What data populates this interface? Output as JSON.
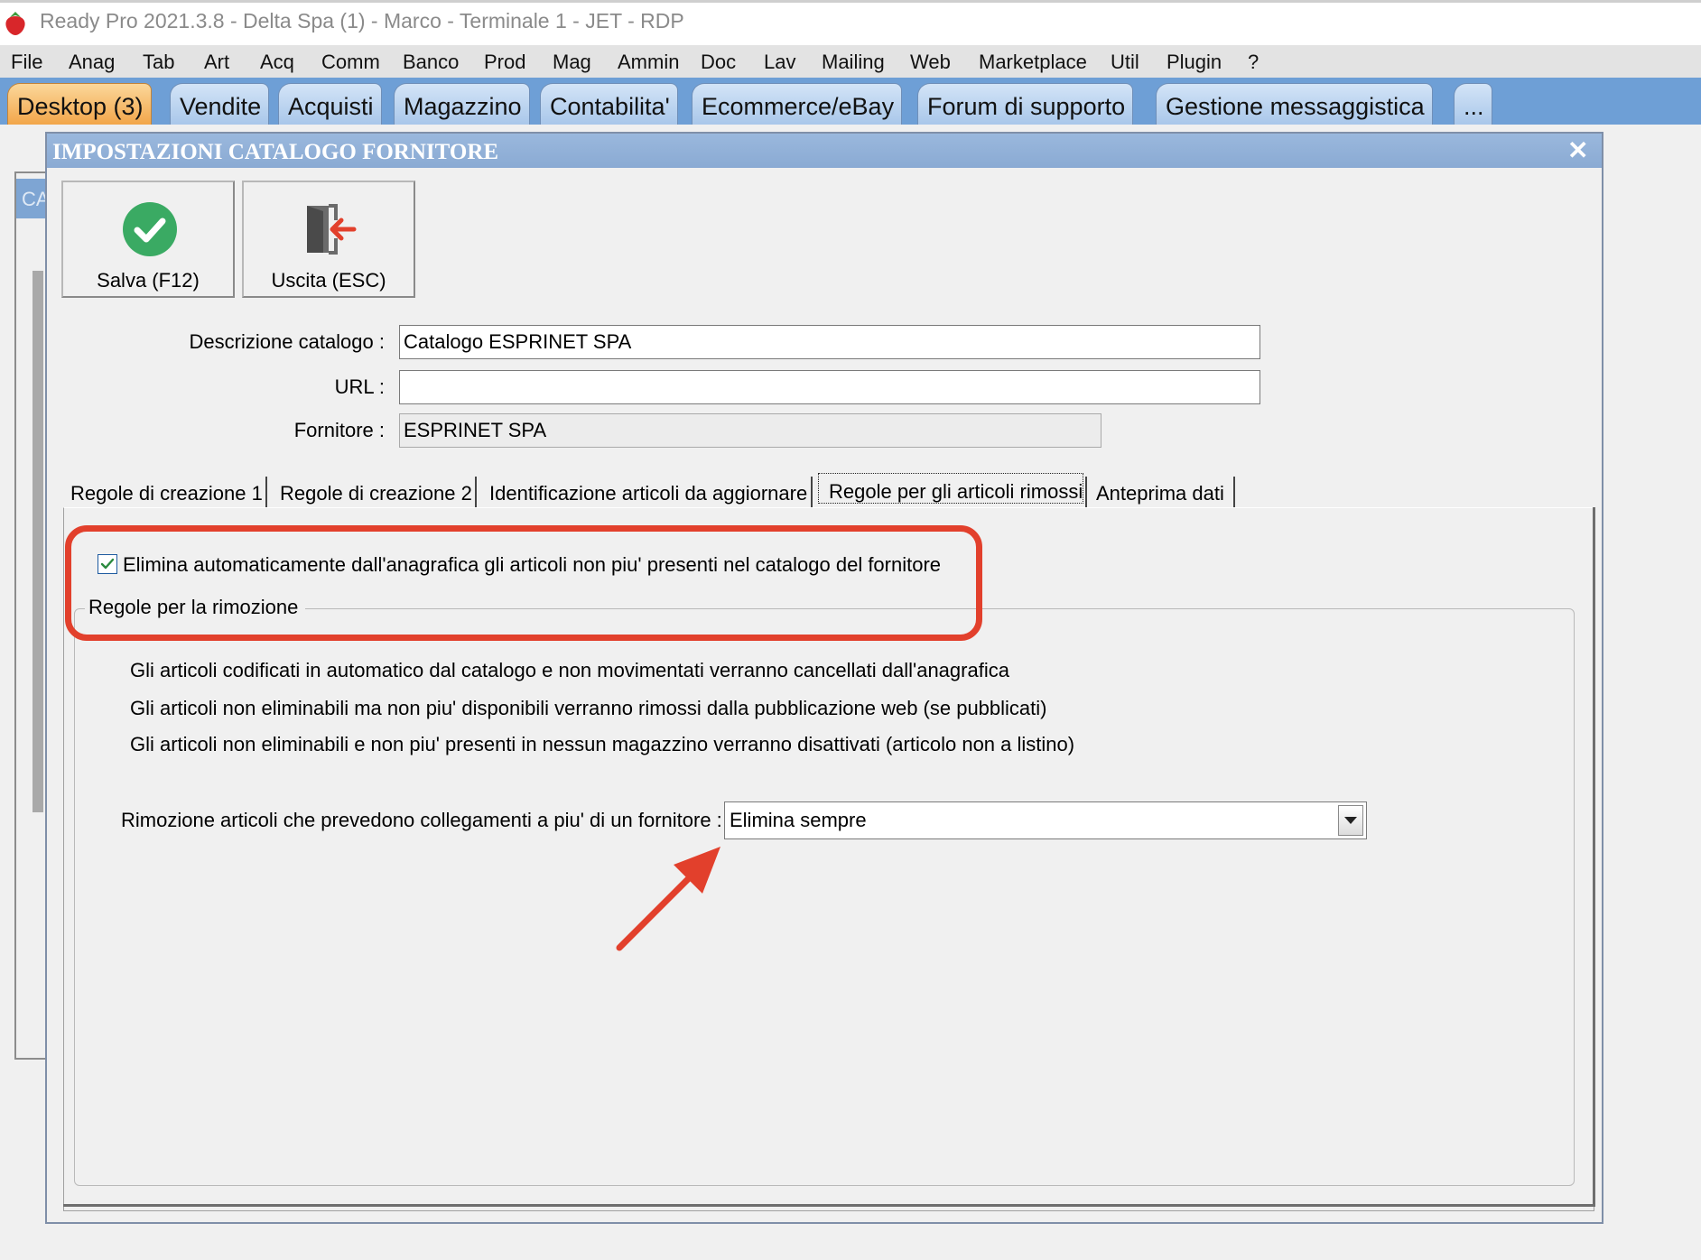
{
  "window": {
    "title": "Ready Pro 2021.3.8 - Delta Spa (1) - Marco - Terminale 1 - JET - RDP"
  },
  "menu": [
    "File",
    "Anag",
    "Tab",
    "Art",
    "Acq",
    "Comm",
    "Banco",
    "Prod",
    "Mag",
    "Ammin",
    "Doc",
    "Lav",
    "Mailing",
    "Web",
    "Marketplace",
    "Util",
    "Plugin",
    "?"
  ],
  "top_tabs": [
    "Desktop (3)",
    "Vendite",
    "Acquisti",
    "Magazzino",
    "Contabilita'",
    "Ecommerce/eBay",
    "Forum di supporto",
    "Gestione messaggistica",
    "..."
  ],
  "background": {
    "tab_fragment": "CA"
  },
  "dialog": {
    "title": "IMPOSTAZIONI CATALOGO FORNITORE",
    "close_glyph": "✕",
    "toolbar": {
      "save_label": "Salva (F12)",
      "exit_label": "Uscita (ESC)"
    },
    "fields": {
      "descrizione_label": "Descrizione catalogo :",
      "descrizione_value": "Catalogo ESPRINET SPA",
      "url_label": "URL :",
      "url_value": "",
      "fornitore_label": "Fornitore :",
      "fornitore_value": "ESPRINET SPA"
    },
    "tabs": [
      "Regole di creazione 1",
      "Regole di creazione 2",
      "Identificazione articoli da aggiornare",
      "Regole per gli articoli rimossi",
      "Anteprima dati"
    ],
    "active_tab": "Regole per gli articoli rimossi",
    "removed_tab": {
      "checkbox_label": "Elimina automaticamente dall'anagrafica gli articoli non piu' presenti nel catalogo del fornitore",
      "checkbox_checked": true,
      "group_title": "Regole per la rimozione",
      "rules": [
        "Gli articoli codificati in automatico dal catalogo e non movimentati verranno cancellati dall'anagrafica",
        "Gli articoli non eliminabili ma non piu' disponibili verranno rimossi dalla pubblicazione web (se pubblicati)",
        "Gli articoli non eliminabili e non piu' presenti in nessun magazzino verranno disattivati (articolo non a listino)"
      ],
      "combo_label": "Rimozione articoli che prevedono collegamenti a piu' di un fornitore :",
      "combo_value": "Elimina sempre"
    }
  },
  "colors": {
    "annotation_red": "#e2402c",
    "tab_strip": "#6e9fd6",
    "active_tab": "#f2a64a",
    "dialog_title": "#8aaad3",
    "check_green": "#3aaa63"
  },
  "icons": {
    "app": "strawberry-icon",
    "save": "check-circle-icon",
    "exit": "exit-door-icon",
    "combo": "dropdown-arrow-icon"
  }
}
